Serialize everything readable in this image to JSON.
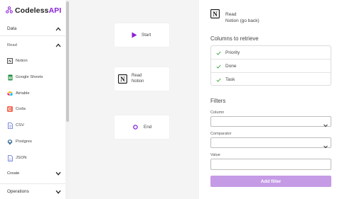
{
  "brand": {
    "name_prefix": "Codeless",
    "name_suffix": "API",
    "icon": "node-graph-icon",
    "accent": "#8b1fd6"
  },
  "sidebar": {
    "sections": [
      {
        "label": "Data"
      },
      {
        "label": "Create"
      },
      {
        "label": "Operations"
      }
    ],
    "read_label": "Read",
    "items": [
      {
        "label": "Notion",
        "icon": "notion-icon"
      },
      {
        "label": "Google Sheets",
        "icon": "google-sheets-icon"
      },
      {
        "label": "Airtable",
        "icon": "airtable-icon"
      },
      {
        "label": "Coda",
        "icon": "coda-icon"
      },
      {
        "label": "CSV",
        "icon": "csv-icon"
      },
      {
        "label": "Postgres",
        "icon": "postgres-icon"
      },
      {
        "label": "JSON",
        "icon": "json-icon"
      }
    ]
  },
  "canvas": {
    "nodes": [
      {
        "label": "Start",
        "icon": "play-icon"
      },
      {
        "line1": "Read",
        "line2": "Notion",
        "icon": "notion-icon"
      },
      {
        "label": "End",
        "icon": "end-circle-icon"
      }
    ]
  },
  "panel": {
    "header": {
      "line1": "Read",
      "line2": "Notion (go back)"
    },
    "columns_title": "Columns to retrieve",
    "columns": [
      {
        "label": "Priority",
        "checked": true
      },
      {
        "label": "Done",
        "checked": true
      },
      {
        "label": "Task",
        "checked": true
      }
    ],
    "filters_title": "Filters",
    "column_label": "Column",
    "column_value": "",
    "comparator_label": "Comparator",
    "comparator_value": "",
    "value_label": "Value",
    "value_value": "",
    "add_filter_label": "Add filter",
    "colors": {
      "check": "#4caf50",
      "button": "#c59be6",
      "play": "#8b1fd6"
    }
  }
}
